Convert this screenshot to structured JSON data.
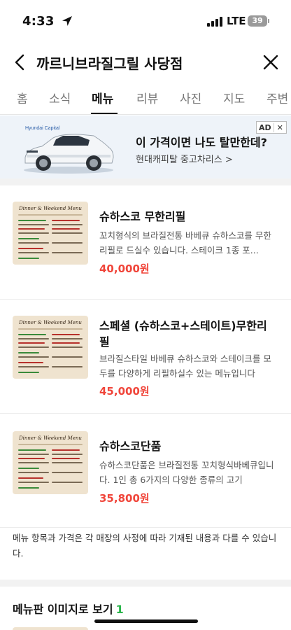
{
  "status": {
    "time": "4:33",
    "network": "LTE",
    "battery": "39"
  },
  "header": {
    "title": "까르니브라질그릴 사당점"
  },
  "tabs": [
    {
      "label": "홈"
    },
    {
      "label": "소식"
    },
    {
      "label": "메뉴",
      "active": true
    },
    {
      "label": "리뷰"
    },
    {
      "label": "사진"
    },
    {
      "label": "지도"
    },
    {
      "label": "주변"
    }
  ],
  "ad": {
    "brand": "Hyundai Capital",
    "headline": "이 가격이면 나도 탈만한데?",
    "subline": "현대캐피탈 중고차리스 >",
    "badge": "AD",
    "close": "✕"
  },
  "menu_thumb_title": "Dinner & Weekend Menu",
  "menu_items": [
    {
      "name": "슈하스코 무한리필",
      "description": "꼬치형식의 브라질전통 바베큐 슈하스코를 무한리필로 드실수 있습니다. 스테이크 1종 포...",
      "price": "40,000원"
    },
    {
      "name": "스페셜 (슈하스코+스테이트)무한리필",
      "description": "브라질스타일 바베큐 슈하스코와 스테이크를 모두를 다양하게 리필하실수 있는 메뉴입니다",
      "price": "45,000원"
    },
    {
      "name": "슈하스코단품",
      "description": "슈하스코단품은 브라질전통 꼬치형식바베큐입니다. 1인 총 6가지의 다양한 종류의 고기",
      "price": "35,800원"
    }
  ],
  "notice": "메뉴 항목과 가격은 각 매장의 사정에 따라 기재된 내용과 다를 수 있습니다.",
  "menu_board": {
    "title": "메뉴판 이미지로 보기",
    "count": "1"
  },
  "colors": {
    "price": "#f0453a",
    "count": "#2ab54b",
    "ad_bg": "#eef3f9"
  }
}
